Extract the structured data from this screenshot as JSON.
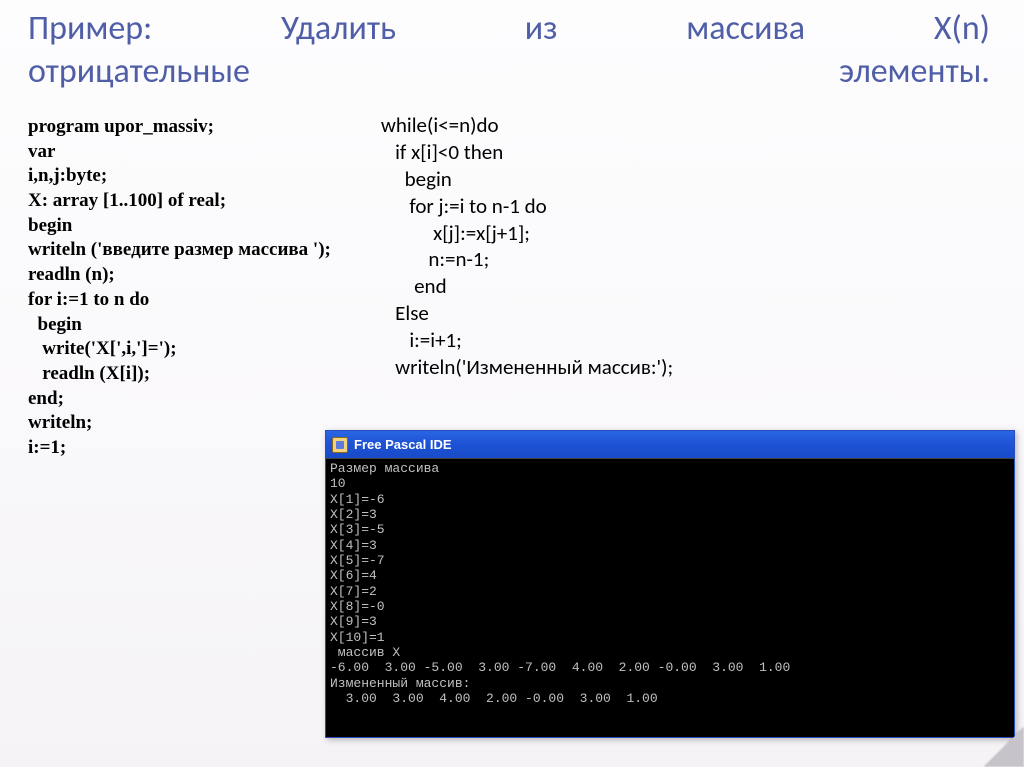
{
  "title": "Пример:   Удалить   из   массива   X(n)\nотрицательные элементы.",
  "leftCode": "program upor_massiv;\nvar\ni,n,j:byte;\nX: array [1..100] of real;\nbegin\nwriteln ('введите размер массива ');\nreadln (n);\nfor i:=1 to n do\n  begin\n   write('X[',i,']=');\n   readln (X[i]);\nend;\nwriteln;\ni:=1;",
  "rightCode": "while(i<=n)do\n   if x[i]<0 then\n     begin\n      for j:=i to n-1 do\n           x[j]:=x[j+1];\n          n:=n-1;\n       end\n   Else\n      i:=i+1;\n   writeln('Измененный массив:');",
  "ideTitle": "Free Pascal IDE",
  "console": "Размер массива\n10\nX[1]=-6\nX[2]=3\nX[3]=-5\nX[4]=3\nX[5]=-7\nX[6]=4\nX[7]=2\nX[8]=-0\nX[9]=3\nX[10]=1\n массив X\n-6.00  3.00 -5.00  3.00 -7.00  4.00  2.00 -0.00  3.00  1.00\nИзмененный массив:\n  3.00  3.00  4.00  2.00 -0.00  3.00  1.00"
}
